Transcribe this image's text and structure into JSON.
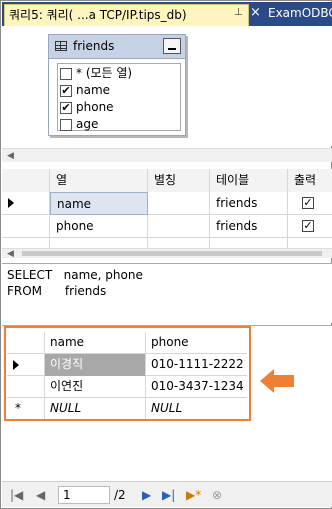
{
  "tabs": {
    "active": {
      "title": "쿼리5: 쿼리(          ...a TCP/IP.tips_db)",
      "pin": "⊥"
    },
    "close": "×",
    "inactive": "ExamODBC"
  },
  "diagram": {
    "table_name": "friends",
    "columns": [
      {
        "label": "* (모든 열)",
        "checked": false
      },
      {
        "label": "name",
        "checked": true
      },
      {
        "label": "phone",
        "checked": true
      },
      {
        "label": "age",
        "checked": false
      }
    ]
  },
  "criteria": {
    "headers": [
      "열",
      "별칭",
      "테이블",
      "출력"
    ],
    "rows": [
      {
        "column": "name",
        "alias": "",
        "table": "friends",
        "output": true
      },
      {
        "column": "phone",
        "alias": "",
        "table": "friends",
        "output": true
      }
    ]
  },
  "sql": {
    "line1": "SELECT   name, phone",
    "line2": "FROM      friends"
  },
  "results": {
    "headers": [
      "name",
      "phone"
    ],
    "rows": [
      {
        "name": "이경직",
        "phone": "010-1111-2222"
      },
      {
        "name": "이연진",
        "phone": "010-3437-1234"
      },
      {
        "name": "NULL",
        "phone": "NULL"
      }
    ],
    "new_row_marker": "*"
  },
  "nav": {
    "current_page": "1",
    "total_pages": "/2"
  },
  "colors": {
    "tab_bar": "#2b4b88",
    "active_tab": "#fdf4bf",
    "highlight": "#ef7f32"
  }
}
